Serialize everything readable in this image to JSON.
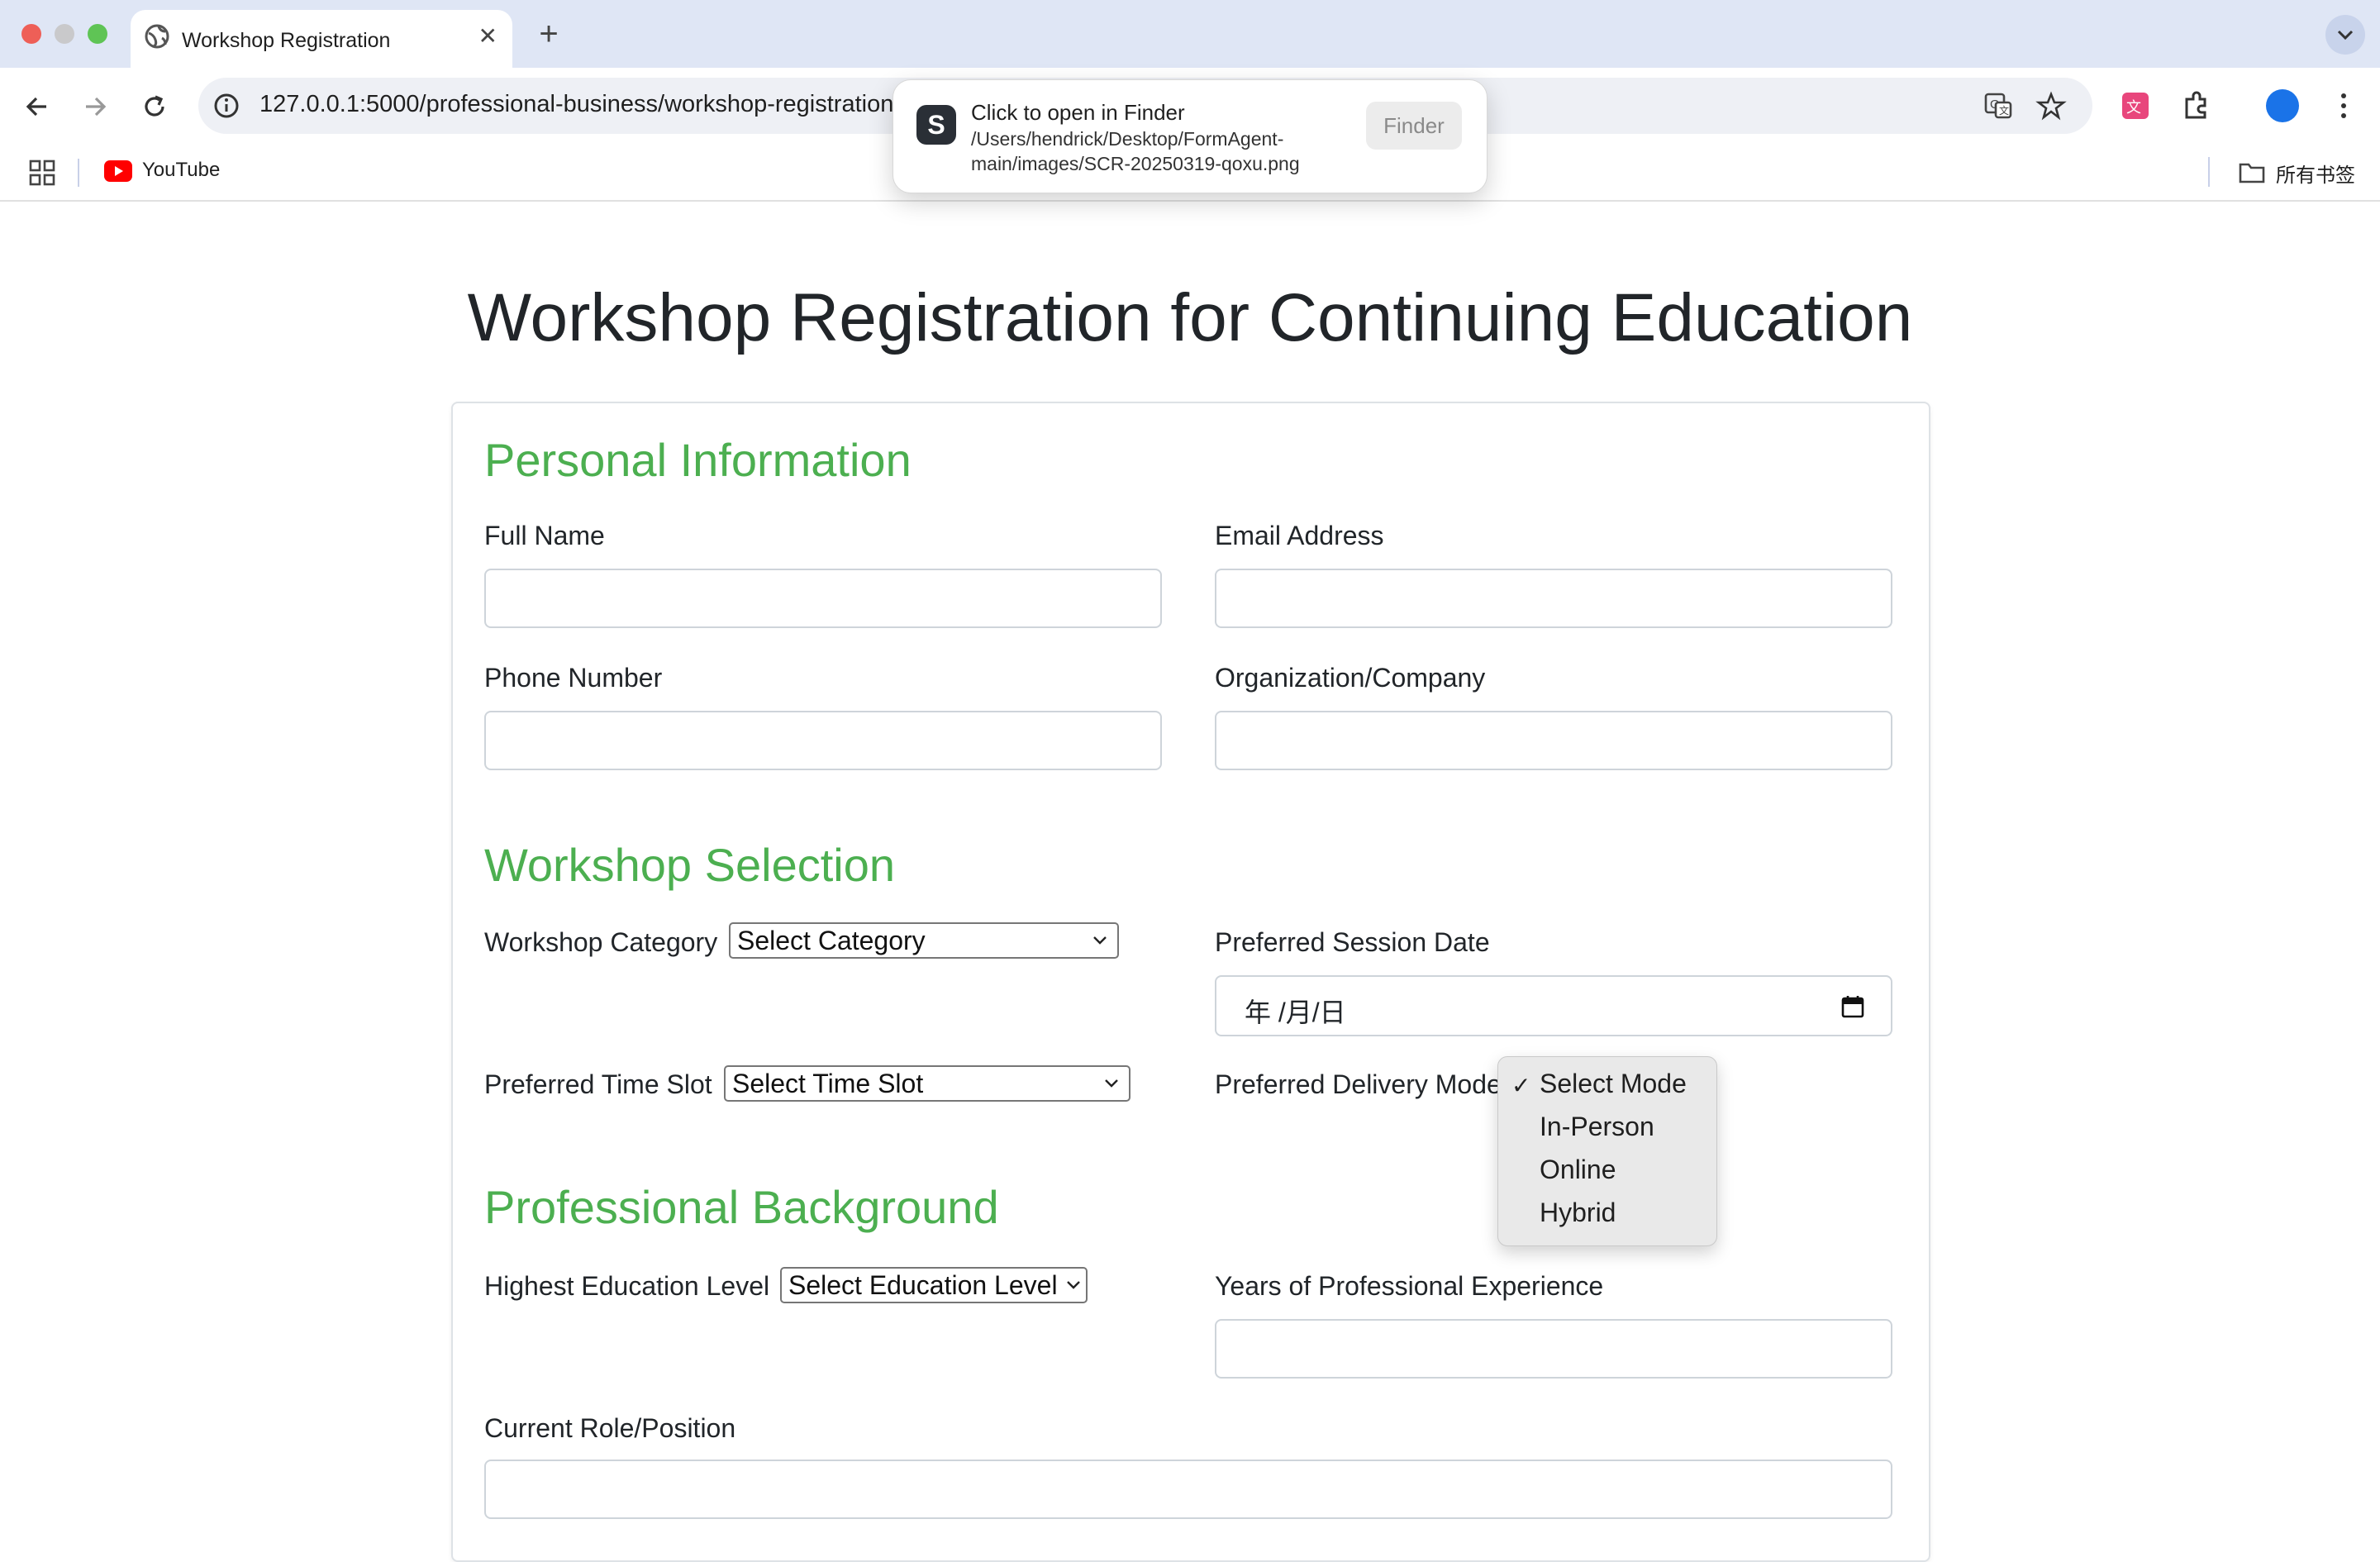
{
  "browser": {
    "tab_title": "Workshop Registration",
    "url": "127.0.0.1:5000/professional-business/workshop-registration",
    "bookmarks": {
      "youtube_label": "YouTube",
      "all_bookmarks_label": "所有书签"
    },
    "icons": [
      "back-icon",
      "forward-icon",
      "reload-icon",
      "site-info-icon",
      "translate-icon",
      "bookmark-star-icon",
      "extension-icon",
      "puzzle-icon",
      "profile-avatar",
      "menu-kebab-icon"
    ]
  },
  "popup": {
    "app_letter": "S",
    "title": "Click to open in Finder",
    "path": "/Users/hendrick/Desktop/FormAgent-main/images/SCR-20250319-qoxu.png",
    "button_label": "Finder"
  },
  "page": {
    "title": "Workshop Registration for Continuing Education",
    "sections": {
      "personal": "Personal Information",
      "workshop": "Workshop Selection",
      "background": "Professional Background"
    },
    "fields": {
      "full_name": "Full Name",
      "email": "Email Address",
      "phone": "Phone Number",
      "organization": "Organization/Company",
      "workshop_category": "Workshop Category",
      "workshop_category_value": "Select Category",
      "session_date": "Preferred Session Date",
      "session_date_placeholder": "年 /月/日",
      "time_slot": "Preferred Time Slot",
      "time_slot_value": "Select Time Slot",
      "delivery_mode": "Preferred Delivery Mode",
      "education_level": "Highest Education Level",
      "education_level_value": "Select Education Level",
      "experience": "Years of Professional Experience",
      "current_role": "Current Role/Position"
    },
    "delivery_mode_menu": {
      "selected": "Select Mode",
      "options": [
        "Select Mode",
        "In-Person",
        "Online",
        "Hybrid"
      ]
    }
  },
  "colors": {
    "section_heading": "#4caf50",
    "tabbar_bg": "#dfe6f5"
  }
}
